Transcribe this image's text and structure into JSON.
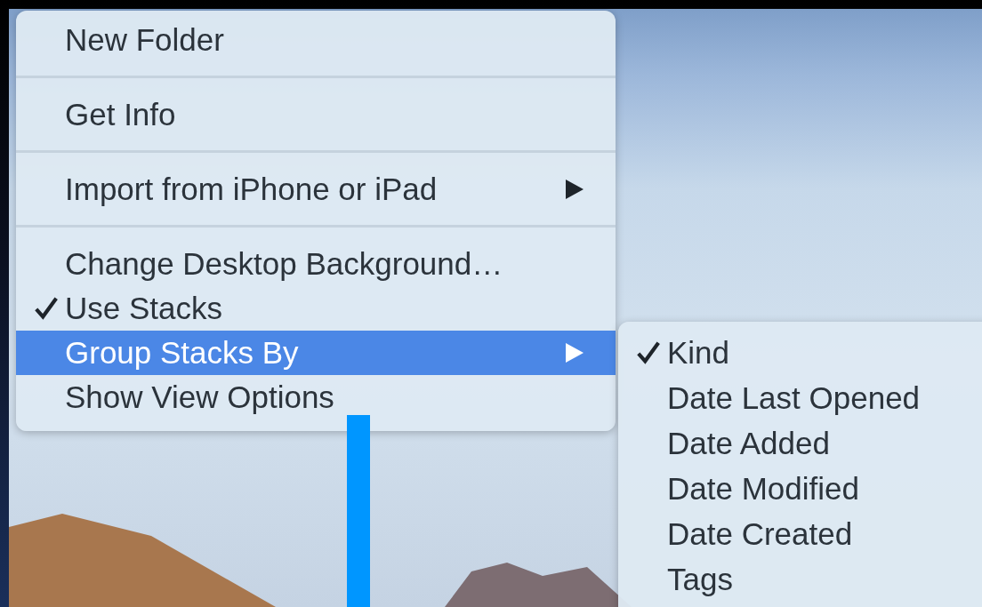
{
  "context_menu": {
    "items": [
      {
        "kind": "item",
        "label": "New Folder",
        "checked": false,
        "selected": false,
        "has_submenu": false
      },
      {
        "kind": "separator"
      },
      {
        "kind": "item",
        "label": "Get Info",
        "checked": false,
        "selected": false,
        "has_submenu": false
      },
      {
        "kind": "separator"
      },
      {
        "kind": "item",
        "label": "Import from iPhone or iPad",
        "checked": false,
        "selected": false,
        "has_submenu": true
      },
      {
        "kind": "separator"
      },
      {
        "kind": "item",
        "label": "Change Desktop Background…",
        "checked": false,
        "selected": false,
        "has_submenu": false
      },
      {
        "kind": "item",
        "label": "Use Stacks",
        "checked": true,
        "selected": false,
        "has_submenu": false
      },
      {
        "kind": "item",
        "label": "Group Stacks By",
        "checked": false,
        "selected": true,
        "has_submenu": true
      },
      {
        "kind": "item",
        "label": "Show View Options",
        "checked": false,
        "selected": false,
        "has_submenu": false
      }
    ]
  },
  "submenu": {
    "items": [
      {
        "kind": "item",
        "label": "Kind",
        "checked": true,
        "selected": false,
        "has_submenu": false
      },
      {
        "kind": "item",
        "label": "Date Last Opened",
        "checked": false,
        "selected": false,
        "has_submenu": false
      },
      {
        "kind": "item",
        "label": "Date Added",
        "checked": false,
        "selected": false,
        "has_submenu": false
      },
      {
        "kind": "item",
        "label": "Date Modified",
        "checked": false,
        "selected": false,
        "has_submenu": false
      },
      {
        "kind": "item",
        "label": "Date Created",
        "checked": false,
        "selected": false,
        "has_submenu": false
      },
      {
        "kind": "item",
        "label": "Tags",
        "checked": false,
        "selected": false,
        "has_submenu": false
      }
    ]
  }
}
